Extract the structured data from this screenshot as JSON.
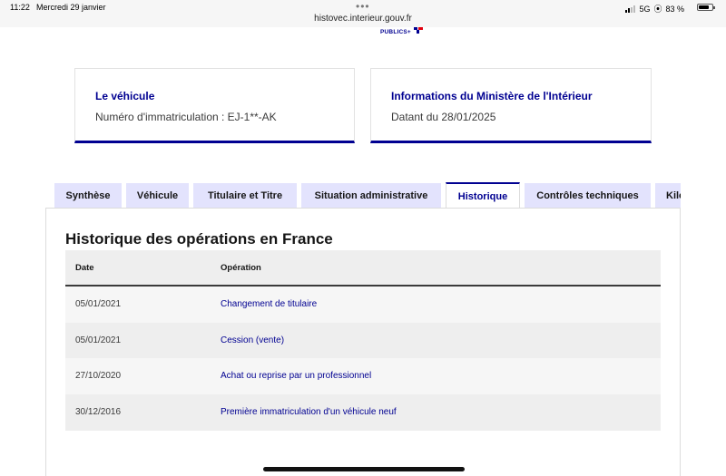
{
  "status_bar": {
    "time": "11:22",
    "date": "Mercredi 29 janvier",
    "url": "histovec.interieur.gouv.fr",
    "network": "5G",
    "battery": "83 %"
  },
  "logo": {
    "text": "PUBLICS+"
  },
  "vehicle_card": {
    "title": "Le véhicule",
    "subtitle": "Numéro d'immatriculation : EJ-1**-AK"
  },
  "ministry_card": {
    "title": "Informations du Ministère de l'Intérieur",
    "subtitle": "Datant du 28/01/2025"
  },
  "tabs": [
    {
      "label": "Synthèse"
    },
    {
      "label": "Véhicule"
    },
    {
      "label": "Titulaire et Titre"
    },
    {
      "label": "Situation administrative"
    },
    {
      "label": "Historique"
    },
    {
      "label": "Contrôles techniques"
    },
    {
      "label": "Kilo"
    }
  ],
  "history": {
    "title": "Historique des opérations en France",
    "columns": {
      "date": "Date",
      "operation": "Opération"
    },
    "rows": [
      {
        "date": "05/01/2021",
        "operation": "Changement de titulaire"
      },
      {
        "date": "05/01/2021",
        "operation": "Cession (vente)"
      },
      {
        "date": "27/10/2020",
        "operation": "Achat ou reprise par un professionnel"
      },
      {
        "date": "30/12/2016",
        "operation": "Première immatriculation d'un véhicule neuf"
      }
    ]
  },
  "colors": {
    "primary": "#000091",
    "tab_bg": "#e3e3fd"
  }
}
